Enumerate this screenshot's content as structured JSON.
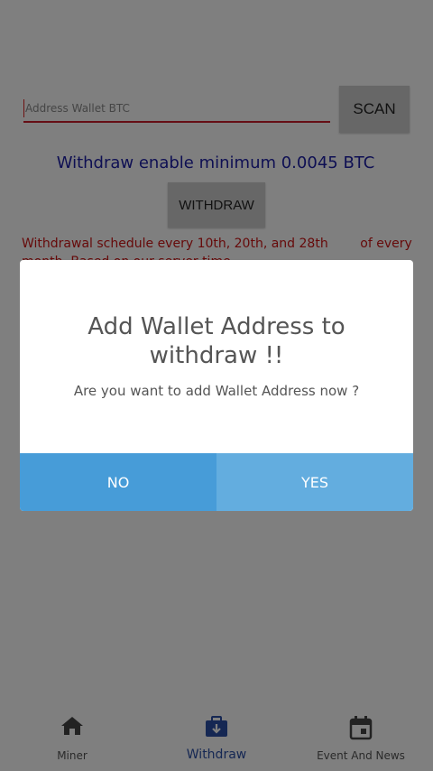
{
  "form": {
    "address_placeholder": "Address Wallet BTC",
    "address_value": "",
    "scan_label": "SCAN",
    "minimum_text": "Withdraw enable minimum 0.0045 BTC",
    "withdraw_label": "WITHDRAW",
    "schedule_text": "Withdrawal schedule every 10th, 20th, and 28th        of every month. Based on our server time"
  },
  "dialog": {
    "title": "Add Wallet Address to withdraw !!",
    "message": "Are you want to add Wallet Address now ?",
    "no_label": "NO",
    "yes_label": "YES"
  },
  "bottom_nav": {
    "items": [
      {
        "label": "Miner",
        "icon": "home-icon",
        "active": false
      },
      {
        "label": "Withdraw",
        "icon": "wallet-icon",
        "active": true
      },
      {
        "label": "Event And News",
        "icon": "calendar-icon",
        "active": false
      }
    ]
  },
  "colors": {
    "accent_blue": "#2a4ea6",
    "minimum_text": "#1d1fa6",
    "schedule_text": "#cc1414",
    "dialog_no": "#479cd8",
    "dialog_yes": "#63addf",
    "input_underline": "#cc1c2a"
  }
}
